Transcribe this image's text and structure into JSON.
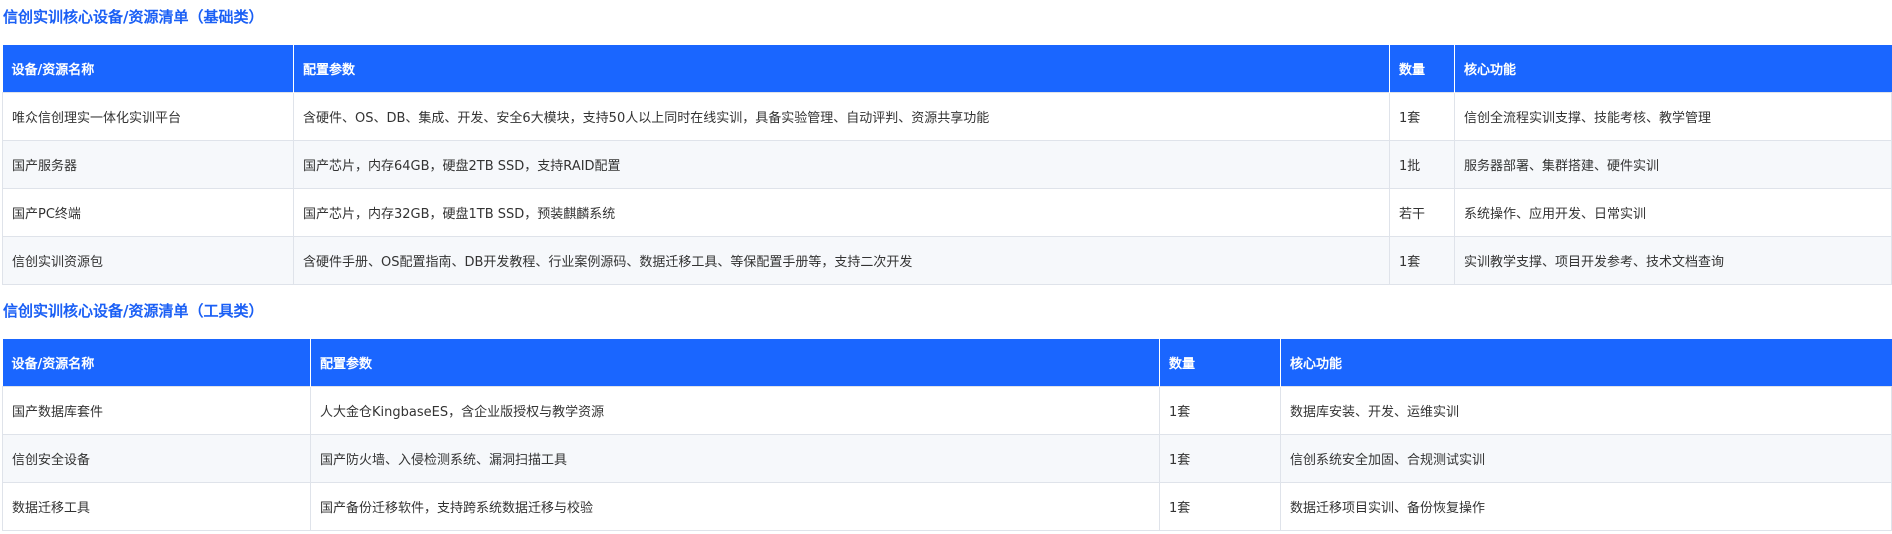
{
  "sections": [
    {
      "title": "信创实训核心设备/资源清单（基础类）",
      "headers": [
        "设备/资源名称",
        "配置参数",
        "数量",
        "核心功能"
      ],
      "rows": [
        [
          "唯众信创理实一体化实训平台",
          "含硬件、OS、DB、集成、开发、安全6大模块，支持50人以上同时在线实训，具备实验管理、自动评判、资源共享功能",
          "1套",
          "信创全流程实训支撑、技能考核、教学管理"
        ],
        [
          "国产服务器",
          "国产芯片，内存64GB，硬盘2TB SSD，支持RAID配置",
          "1批",
          "服务器部署、集群搭建、硬件实训"
        ],
        [
          "国产PC终端",
          "国产芯片，内存32GB，硬盘1TB SSD，预装麒麟系统",
          "若干",
          "系统操作、应用开发、日常实训"
        ],
        [
          "信创实训资源包",
          "含硬件手册、OS配置指南、DB开发教程、行业案例源码、数据迁移工具、等保配置手册等，支持二次开发",
          "1套",
          "实训教学支撑、项目开发参考、技术文档查询"
        ]
      ]
    },
    {
      "title": "信创实训核心设备/资源清单（工具类）",
      "headers": [
        "设备/资源名称",
        "配置参数",
        "数量",
        "核心功能"
      ],
      "rows": [
        [
          "国产数据库套件",
          "人大金仓KingbaseES，含企业版授权与教学资源",
          "1套",
          "数据库安装、开发、运维实训"
        ],
        [
          "信创安全设备",
          "国产防火墙、入侵检测系统、漏洞扫描工具",
          "1套",
          "信创系统安全加固、合规测试实训"
        ],
        [
          "数据迁移工具",
          "国产备份迁移软件，支持跨系统数据迁移与校验",
          "1套",
          "数据迁移项目实训、备份恢复操作"
        ]
      ]
    }
  ]
}
